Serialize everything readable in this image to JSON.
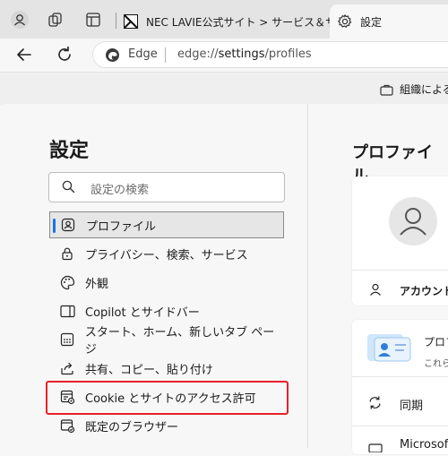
{
  "tabs": [
    {
      "title": "NEC LAVIE公式サイト > サービス＆サ"
    },
    {
      "title": "設定"
    }
  ],
  "address": {
    "site_label": "Edge",
    "url_prefix": "edge://",
    "url_bold": "settings",
    "url_suffix": "/profiles"
  },
  "infobar": {
    "text": "組織による"
  },
  "settings": {
    "title": "設定",
    "search_placeholder": "設定の検索",
    "nav": [
      {
        "label": "プロファイル",
        "icon": "profile-icon"
      },
      {
        "label": "プライバシー、検索、サービス",
        "icon": "lock-icon"
      },
      {
        "label": "外観",
        "icon": "palette-icon"
      },
      {
        "label": "Copilot とサイドバー",
        "icon": "sidebar-icon"
      },
      {
        "label": "スタート、ホーム、新しいタブ ページ",
        "icon": "home-grid-icon"
      },
      {
        "label": "共有、コピー、貼り付け",
        "icon": "share-icon"
      },
      {
        "label": "Cookie とサイトのアクセス許可",
        "icon": "cookie-settings-icon"
      },
      {
        "label": "既定のブラウザー",
        "icon": "browser-icon"
      }
    ]
  },
  "profile": {
    "title": "プロファイル",
    "account_label": "アカウント",
    "card2_title": "プロフ",
    "card2_sub": "これら",
    "sync_label": "同期",
    "microsoft_label": "Microsoft"
  }
}
